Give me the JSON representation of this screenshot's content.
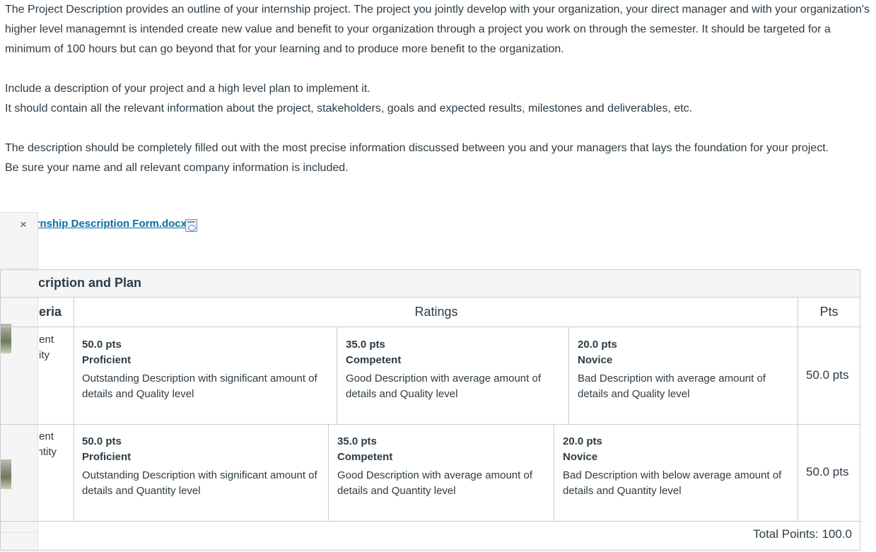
{
  "intro": {
    "p1": "The Project Description provides an outline of your internship project.  The project you jointly develop with your organization, your direct manager and with your organization's higher level managemnt is intended create new value and benefit to your organization through a project you work on through the semester.  It should be targeted for a minimum of 100 hours but can go beyond that for your learning and to produce more benefit to the organization.",
    "p2": "Include a description of your project and a high level plan to implement it.",
    "p3": "It should contain all the relevant information about the project, stakeholders, goals and expected results, milestones and deliverables, etc.",
    "p4": "The description should be completely filled out with the most precise information discussed between you and your managers that lays the foundation for your project.",
    "p5": "Be sure your name and all relevant company information is included."
  },
  "attachment": {
    "close_symbol": "×",
    "file_name": "Project Internship Description Form.docx",
    "icon": "docx-file-icon"
  },
  "rubric": {
    "title": "Project Description and Plan",
    "headers": {
      "criteria": "Criteria",
      "ratings": "Ratings",
      "pts": "Pts"
    },
    "criteria": [
      {
        "label_line1": "Content",
        "label_line2": "Quality",
        "pts": "50.0 pts",
        "ratings": [
          {
            "pts": "50.0 pts",
            "level": "Proficient",
            "desc": "Outstanding Description with significant amount of details and Quality level"
          },
          {
            "pts": "35.0 pts",
            "level": "Competent",
            "desc": "Good Description with average amount of details and Quality level"
          },
          {
            "pts": "20.0 pts",
            "level": "Novice",
            "desc": "Bad Description with average amount of details and Quality level"
          }
        ]
      },
      {
        "label_line1": "Content",
        "label_line2": "Quantity",
        "pts": "50.0 pts",
        "ratings": [
          {
            "pts": "50.0 pts",
            "level": "Proficient",
            "desc": "Outstanding Description with significant amount of details and Quantity level"
          },
          {
            "pts": "35.0 pts",
            "level": "Competent",
            "desc": "Good Description with average amount of details and Quantity level"
          },
          {
            "pts": "20.0 pts",
            "level": "Novice",
            "desc": "Bad Description with below average amount of details and Quantity level"
          }
        ]
      }
    ],
    "total": "Total Points: 100.0"
  }
}
